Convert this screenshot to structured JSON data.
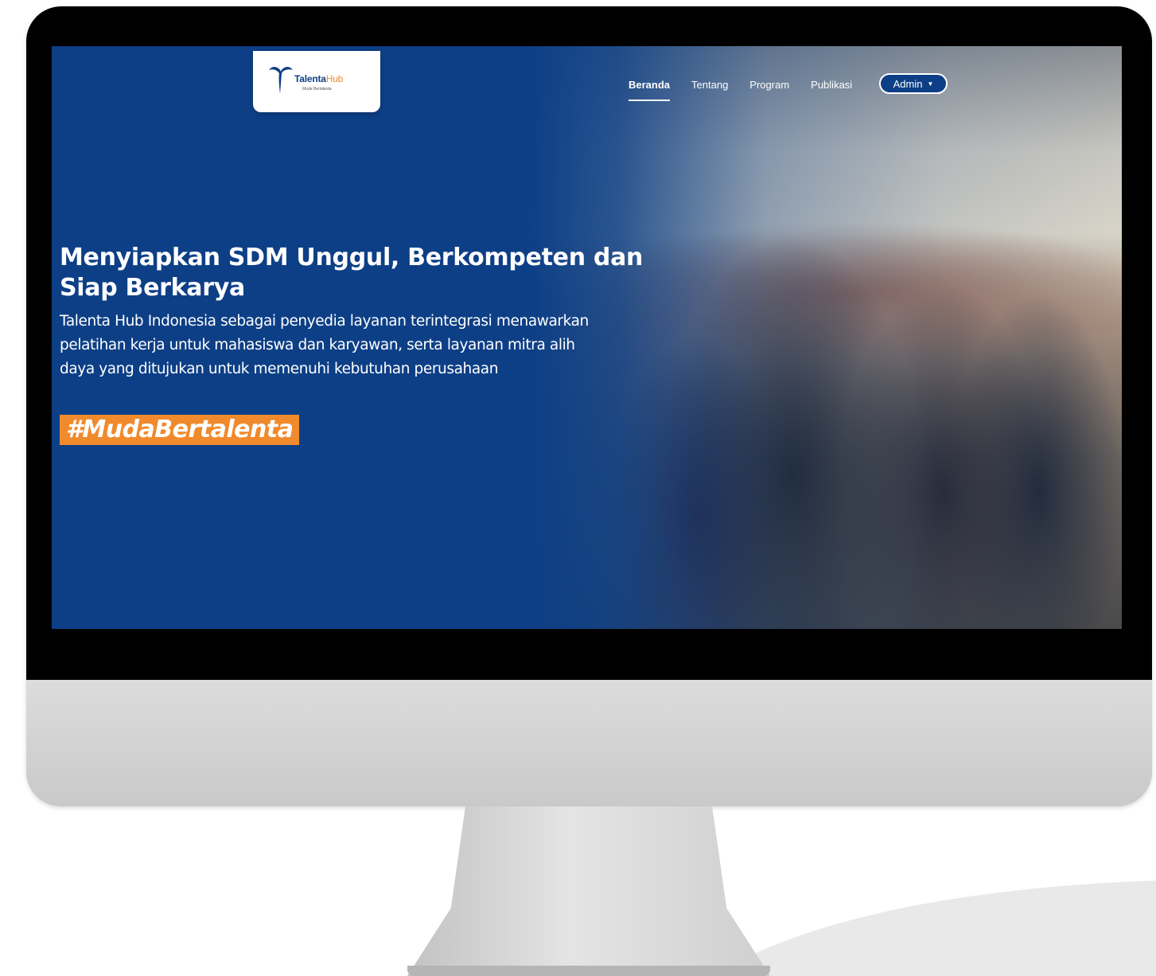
{
  "brand": {
    "logo_name": "Talenta",
    "logo_hub": "Hub",
    "logo_tagline": "Muda Bertalenta"
  },
  "nav": {
    "items": [
      {
        "label": "Beranda",
        "active": true
      },
      {
        "label": "Tentang",
        "active": false
      },
      {
        "label": "Program",
        "active": false
      },
      {
        "label": "Publikasi",
        "active": false
      }
    ],
    "admin_label": "Admin"
  },
  "hero": {
    "title": "Menyiapkan SDM Unggul, Berkompeten dan Siap Berkarya",
    "description": "Talenta Hub Indonesia sebagai penyedia layanan terintegrasi menawarkan pelatihan kerja untuk mahasiswa dan karyawan, serta layanan mitra alih daya yang ditujukan untuk memenuhi kebutuhan perusahaan",
    "hashtag": "#MudaBertalenta"
  },
  "colors": {
    "primary_blue": "#0d3f86",
    "accent_orange": "#f08a2c"
  }
}
